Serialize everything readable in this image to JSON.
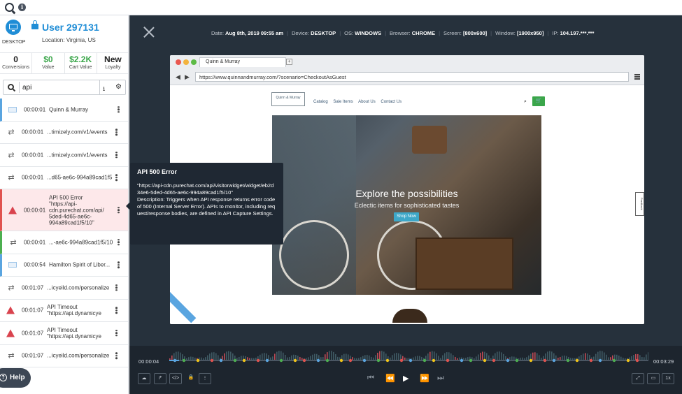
{
  "user": {
    "device_label": "DESKTOP",
    "name": "User 297131",
    "location": "Location: Virginia, US"
  },
  "stats": [
    {
      "value": "0",
      "label": "Conversions",
      "color": "#222222"
    },
    {
      "value": "$0",
      "label": "Value",
      "color": "#3aa64a"
    },
    {
      "value": "$2.2K",
      "label": "Cart Value",
      "color": "#3aa64a"
    },
    {
      "value": "New",
      "label": "Loyalty",
      "color": "#222222"
    }
  ],
  "search": {
    "value": "api"
  },
  "events": [
    {
      "time": "00:00:01",
      "text": "Quinn & Murray",
      "icon": "page-icon",
      "accent": "blue"
    },
    {
      "time": "00:00:01",
      "text": "...timizely.com/v1/events",
      "icon": "swap-arrows-icon",
      "accent": "none"
    },
    {
      "time": "00:00:01",
      "text": "...timizely.com/v1/events",
      "icon": "swap-arrows-icon",
      "accent": "none"
    },
    {
      "time": "00:00:01",
      "text": "...d65-ae6c-994a89cad1f5",
      "icon": "swap-arrows-icon",
      "accent": "none"
    },
    {
      "time": "00:00:01",
      "text": "API 500 Error\n\"https://api-\ncdn.purechat.com/api/\n5ded-4d65-ae6c-\n994a89cad1f5/10\"",
      "icon": "warning-icon",
      "accent": "red",
      "tall": true
    },
    {
      "time": "00:00:01",
      "text": "...-ae6c-994a89cad1f5/10",
      "icon": "swap-arrows-icon",
      "accent": "green"
    },
    {
      "time": "00:00:54",
      "text": "Hamilton Spirit of Liber...",
      "icon": "page-icon",
      "accent": "blue"
    },
    {
      "time": "00:01:07",
      "text": "...icyeild.com/personalize",
      "icon": "swap-arrows-icon",
      "accent": "none"
    },
    {
      "time": "00:01:07",
      "text": "API Timeout\n\"https://api.dynamicye",
      "icon": "warning-icon",
      "accent": "none"
    },
    {
      "time": "00:01:07",
      "text": "API Timeout\n\"https://api.dynamicye",
      "icon": "warning-icon",
      "accent": "none"
    },
    {
      "time": "00:01:07",
      "text": "...icyeild.com/personalize",
      "icon": "swap-arrows-icon",
      "accent": "none"
    }
  ],
  "help_label": "Help",
  "session_meta": [
    {
      "label": "Date:",
      "value": "Aug 8th, 2019 09:55 am"
    },
    {
      "label": "Device:",
      "value": "DESKTOP"
    },
    {
      "label": "OS:",
      "value": "WINDOWS"
    },
    {
      "label": "Browser:",
      "value": "CHROME"
    },
    {
      "label": "Screen:",
      "value": "[800x600]"
    },
    {
      "label": "Window:",
      "value": "[1900x950]"
    },
    {
      "label": "IP:",
      "value": "104.197.***.***"
    }
  ],
  "browser": {
    "tab_title": "Quinn & Murray",
    "new_tab": "+",
    "url": "https://www.quinnandmurray.com/?scenario=CheckoutAsGuest"
  },
  "site": {
    "logo_text": "Quinn & Murray",
    "nav": [
      "Catalog",
      "Sale Items",
      "About Us",
      "Contact Us"
    ],
    "hero_title": "Explore the possibilities",
    "hero_subtitle": "Eclectic items for sophisticated tastes",
    "shop_button": "Shop Now",
    "feedback_tab": "Feedback"
  },
  "tooltip": {
    "title": "API 500 Error",
    "body": "\"https://api-cdn.purechat.com/api/visitorwidget/widget/eb2d34e6-5ded-4d65-ae6c-994a89cad1f5/10\"\nDescription: Triggers when API response returns error code of 500 (Internal Server Error). APIs to monitor, including request/response bodies, are defined in API Capture Settings."
  },
  "timeline": {
    "current": "00:00:04",
    "total": "00:03:29",
    "progress": 0.02,
    "speed": "1x"
  },
  "colors": {
    "accent_blue": "#1f8dd6",
    "error_red": "#d9434e",
    "success_green": "#3aa64a",
    "player_bg": "#26313c"
  }
}
